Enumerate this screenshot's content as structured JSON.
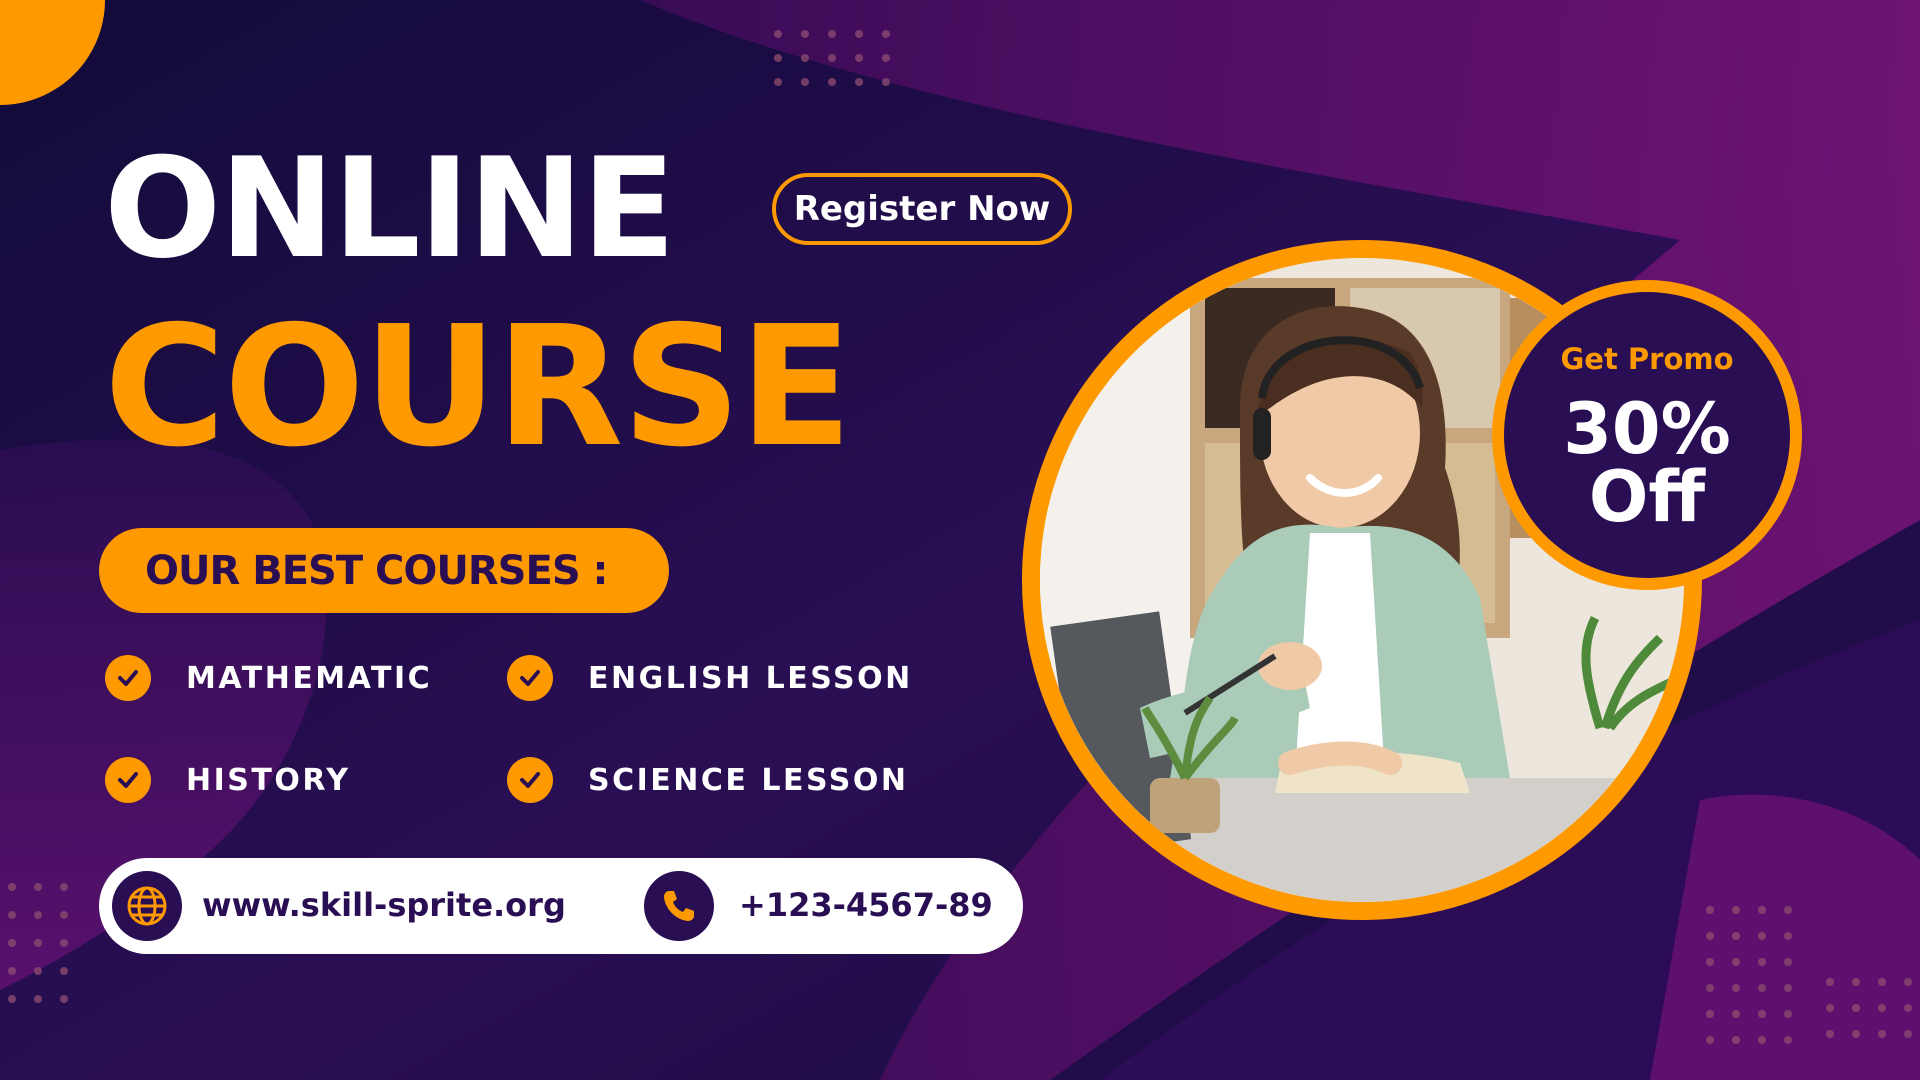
{
  "colors": {
    "background": "#1c0c44",
    "accent": "#ff9900",
    "text_light": "#ffffff",
    "text_dark": "#2a0e54",
    "magenta": "#7a1478"
  },
  "header": {
    "title_line1": "ONLINE",
    "title_line2": "COURSE",
    "register_label": "Register Now"
  },
  "courses": {
    "heading": "OUR BEST COURSES :",
    "items": [
      {
        "label": "MATHEMATIC",
        "icon": "checkmark-icon"
      },
      {
        "label": "ENGLISH LESSON",
        "icon": "checkmark-icon"
      },
      {
        "label": "HISTORY",
        "icon": "checkmark-icon"
      },
      {
        "label": "SCIENCE LESSON",
        "icon": "checkmark-icon"
      }
    ]
  },
  "contact": {
    "website": "www.skill-sprite.org",
    "website_icon": "globe-icon",
    "phone": "+123-4567-89",
    "phone_icon": "phone-icon"
  },
  "promo": {
    "label": "Get Promo",
    "amount": "30%",
    "suffix": "Off"
  },
  "photo": {
    "description_icon": "student-photo"
  }
}
